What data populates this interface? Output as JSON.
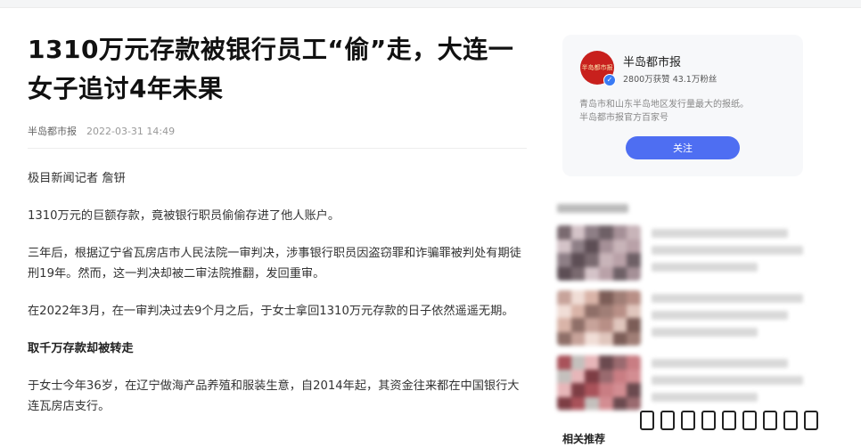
{
  "article": {
    "title": "1310万元存款被银行员工“偷”走，大连一女子追讨4年未果",
    "source": "半岛都市报",
    "date": "2022-03-31 14:49",
    "paragraphs": [
      {
        "text": "极目新闻记者 詹钘",
        "heading": false
      },
      {
        "text": "1310万元的巨额存款，竟被银行职员偷偷存进了他人账户。",
        "heading": false
      },
      {
        "text": "三年后，根据辽宁省瓦房店市人民法院一审判决，涉事银行职员因盗窃罪和诈骗罪被判处有期徒刑19年。然而，这一判决却被二审法院推翻，发回重审。",
        "heading": false
      },
      {
        "text": "在2022年3月，在一审判决过去9个月之后，于女士拿回1310万元存款的日子依然遥遥无期。",
        "heading": false
      },
      {
        "text": "取千万存款却被转走",
        "heading": true
      },
      {
        "text": "于女士今年36岁，在辽宁做海产品养殖和服装生意，自2014年起，其资金往来都在中国银行大连瓦房店支行。",
        "heading": false
      }
    ]
  },
  "source_card": {
    "name": "半岛都市报",
    "avatar_text": "半岛都市报",
    "stats": "2800万获赞 43.1万粉丝",
    "description_line1": "青岛市和山东半岛地区发行量最大的报纸。",
    "description_line2": "半岛都市报官方百家号",
    "follow_label": "关注",
    "verified_icon": "check-badge-icon"
  },
  "related_label": "相关推荐",
  "colors": {
    "accent": "#4e6ef2",
    "avatar_bg": "#c8201d",
    "card_bg": "#f7f8fa"
  }
}
